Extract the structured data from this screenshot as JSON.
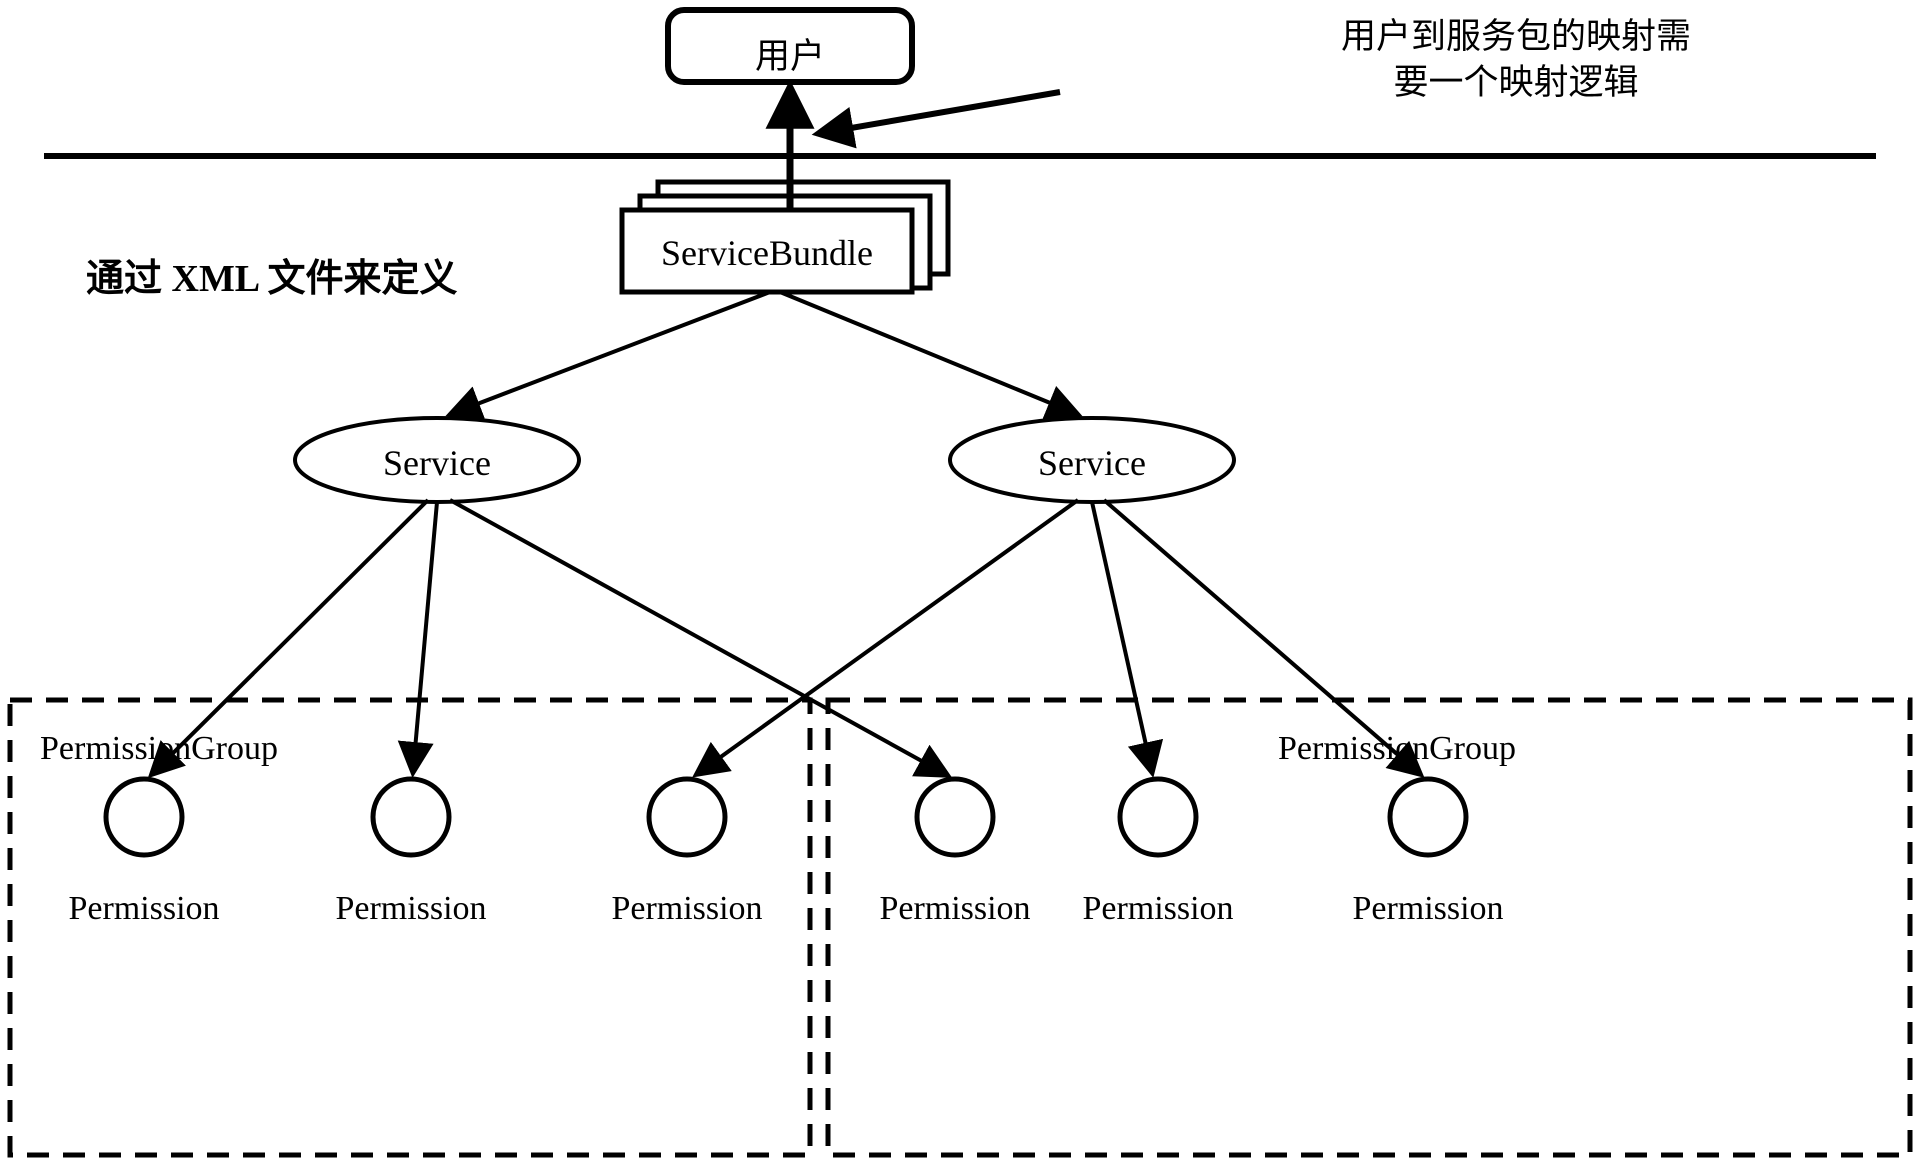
{
  "diagram": {
    "title_note": {
      "line1": "用户到服务包的映射需",
      "line2": "要一个映射逻辑",
      "full": "用户到服务包的映射需\n要一个映射逻辑"
    },
    "xml_note": "通过 XML 文件来定义",
    "user_box": {
      "label": "用户"
    },
    "service_bundle": {
      "label": "ServiceBundle",
      "stack_count": 3
    },
    "services": [
      {
        "label": "Service"
      },
      {
        "label": "Service"
      }
    ],
    "permission_groups": [
      {
        "label": "PermissionGroup",
        "permissions": [
          {
            "label": "Permission"
          },
          {
            "label": "Permission"
          },
          {
            "label": "Permission"
          }
        ]
      },
      {
        "label": "PermissionGroup",
        "permissions": [
          {
            "label": "Permission"
          },
          {
            "label": "Permission"
          },
          {
            "label": "Permission"
          }
        ]
      }
    ],
    "colors": {
      "stroke": "#000000",
      "background": "#ffffff",
      "text": "#000000"
    },
    "icons": {
      "arrow": "arrow-head-icon",
      "divider": "horizontal-divider-icon",
      "group_boundary": "dashed-rectangle-icon"
    }
  }
}
